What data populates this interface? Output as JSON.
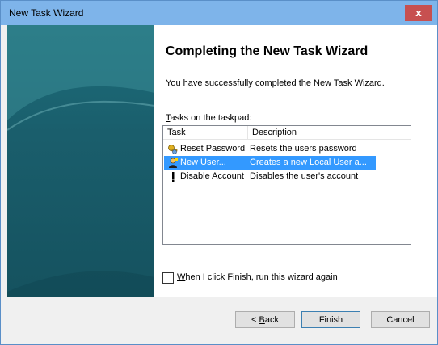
{
  "window": {
    "title": "New Task Wizard",
    "close_glyph": "x"
  },
  "wizard": {
    "heading": "Completing the New Task Wizard",
    "success_message": "You have successfully completed the New Task Wizard.",
    "list_label_accel": "T",
    "list_label_rest": "asks on the taskpad:"
  },
  "tasks_table": {
    "columns": [
      "Task",
      "Description"
    ],
    "rows": [
      {
        "task": "Reset Password",
        "description": "Resets the users password",
        "icon": "reset-password-icon",
        "selected": false
      },
      {
        "task": "New User...",
        "description": "Creates a new Local User a...",
        "icon": "new-user-icon",
        "selected": true
      },
      {
        "task": "Disable Account",
        "description": "Disables the user's account",
        "icon": "disable-account-icon",
        "selected": false
      }
    ]
  },
  "run_again": {
    "accel": "W",
    "rest": "hen I click Finish, run this wizard again",
    "checked": false
  },
  "buttons": {
    "back_prefix": "< ",
    "back_accel": "B",
    "back_rest": "ack",
    "finish": "Finish",
    "cancel": "Cancel"
  },
  "colors": {
    "titlebar": "#7eb4ea",
    "close_button": "#c75050",
    "banner": "#1a5e6c",
    "selection": "#3399ff"
  }
}
